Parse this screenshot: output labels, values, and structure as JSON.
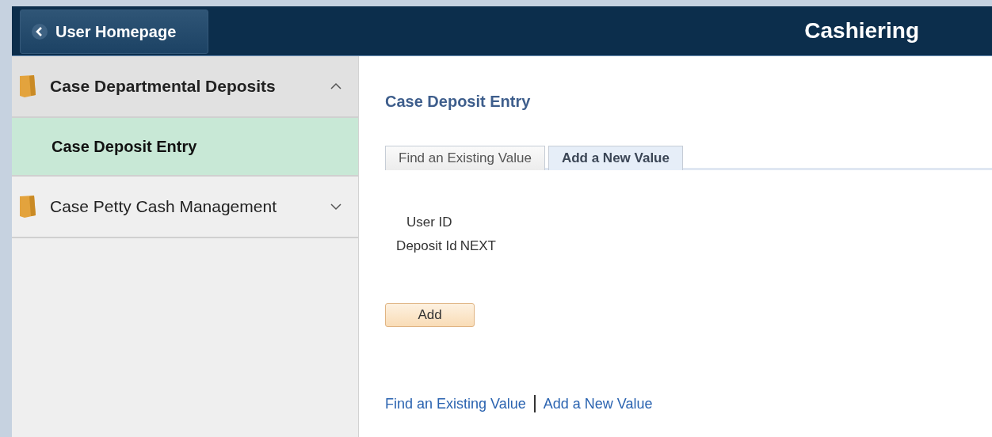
{
  "header": {
    "back_button": "User Homepage",
    "title": "Cashiering"
  },
  "sidebar": {
    "items": [
      {
        "label": "Case Departmental Deposits",
        "expanded": true,
        "children": [
          {
            "label": "Case Deposit Entry",
            "selected": true
          }
        ]
      },
      {
        "label": "Case Petty Cash Management",
        "expanded": false
      }
    ]
  },
  "page_title": "Case Deposit Entry",
  "tabs": [
    {
      "label": "Find an Existing Value",
      "selected": false
    },
    {
      "label": "Add a New Value",
      "selected": true
    }
  ],
  "fields": [
    {
      "label": "User ID"
    },
    {
      "label": "Deposit Id",
      "value": "NEXT"
    }
  ],
  "add_button": "Add",
  "footer_links": [
    "Find an Existing Value",
    "Add a New Value"
  ]
}
